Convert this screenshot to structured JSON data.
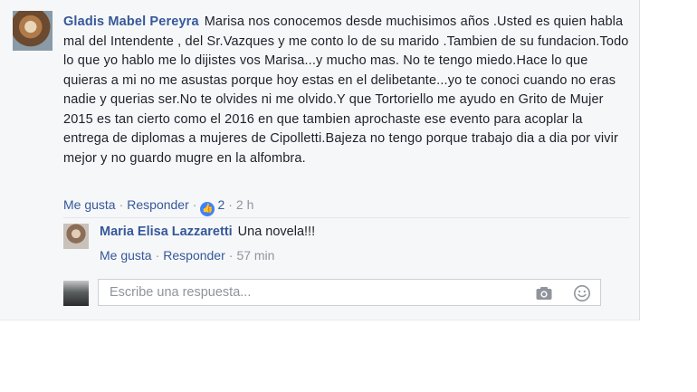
{
  "comment": {
    "author": "Gladis Mabel Pereyra",
    "text": "Marisa nos conocemos desde muchisimos años .Usted es quien habla mal del Intendente , del Sr.Vazques y me conto lo de su marido .Tambien de su fundacion.Todo lo que yo hablo me lo dijistes vos Marisa...y mucho mas. No te tengo miedo.Hace lo que quieras a mi no me asustas porque hoy estas en el delibetante...yo te conoci cuando no eras nadie y querias ser.No te olvides ni me olvido.Y que Tortoriello me ayudo en Grito de Mujer 2015 es tan cierto como el 2016 en que tambien aprochaste ese evento para acoplar la entrega de diplomas a mujeres de Cipolletti.Bajeza no tengo porque trabajo dia a dia por vivir mejor y no guardo mugre en la alfombra.",
    "actions": {
      "like": "Me gusta",
      "reply": "Responder",
      "reaction_count": "2",
      "time": "2 h"
    },
    "reaction_icon": "thumbs-up-icon"
  },
  "reply": {
    "author": "Maria Elisa Lazzaretti",
    "text": "Una novela!!!",
    "actions": {
      "like": "Me gusta",
      "reply": "Responder",
      "time": "57 min"
    }
  },
  "composer": {
    "placeholder": "Escribe una respuesta...",
    "icons": [
      "camera-icon",
      "emoji-icon"
    ]
  },
  "colors": {
    "link": "#365899",
    "text": "#1d2129",
    "meta": "#90949c",
    "like_badge": "#4080ff",
    "panel_bg": "#f6f7f9"
  }
}
